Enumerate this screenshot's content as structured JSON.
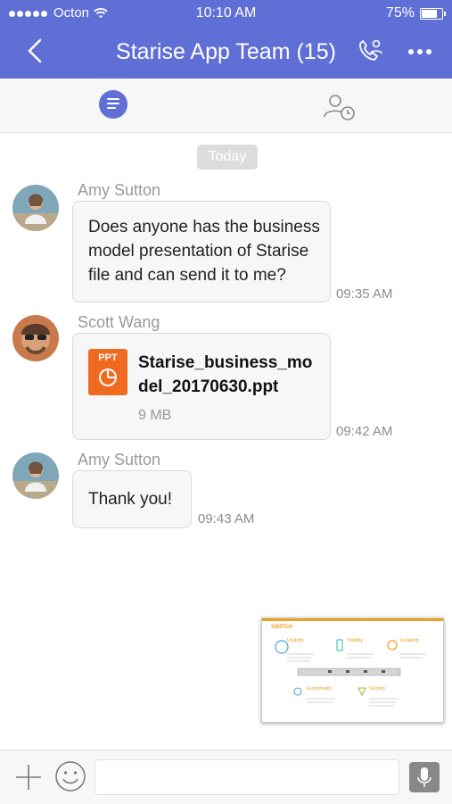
{
  "status": {
    "carrier": "Octon",
    "time": "10:10 AM",
    "battery": "75%"
  },
  "header": {
    "title": "Starise App Team (15)"
  },
  "date_divider": "Today",
  "messages": [
    {
      "sender": "Amy Sutton",
      "lines": [
        "Does anyone has the business",
        "model presentation of Starise",
        "file and can send it to me?"
      ],
      "time": "09:35 AM"
    },
    {
      "sender": "Scott Wang",
      "file": {
        "badge": "PPT",
        "name_lines": [
          "Starise_business_mo",
          "del_20170630.ppt"
        ],
        "size": "9 MB"
      },
      "time": "09:42 AM"
    },
    {
      "sender": "Amy Sutton",
      "lines": [
        "Thank you!"
      ],
      "time": "09:43 AM"
    }
  ],
  "preview_slide": {
    "brand": "SWITCH",
    "sections": [
      "Usability",
      "Visibility",
      "Scalability",
      "Functionality",
      "Security"
    ]
  },
  "colors": {
    "accent": "#5f6fd6",
    "file_orange": "#f06a20",
    "slide_orange": "#f0a020"
  }
}
